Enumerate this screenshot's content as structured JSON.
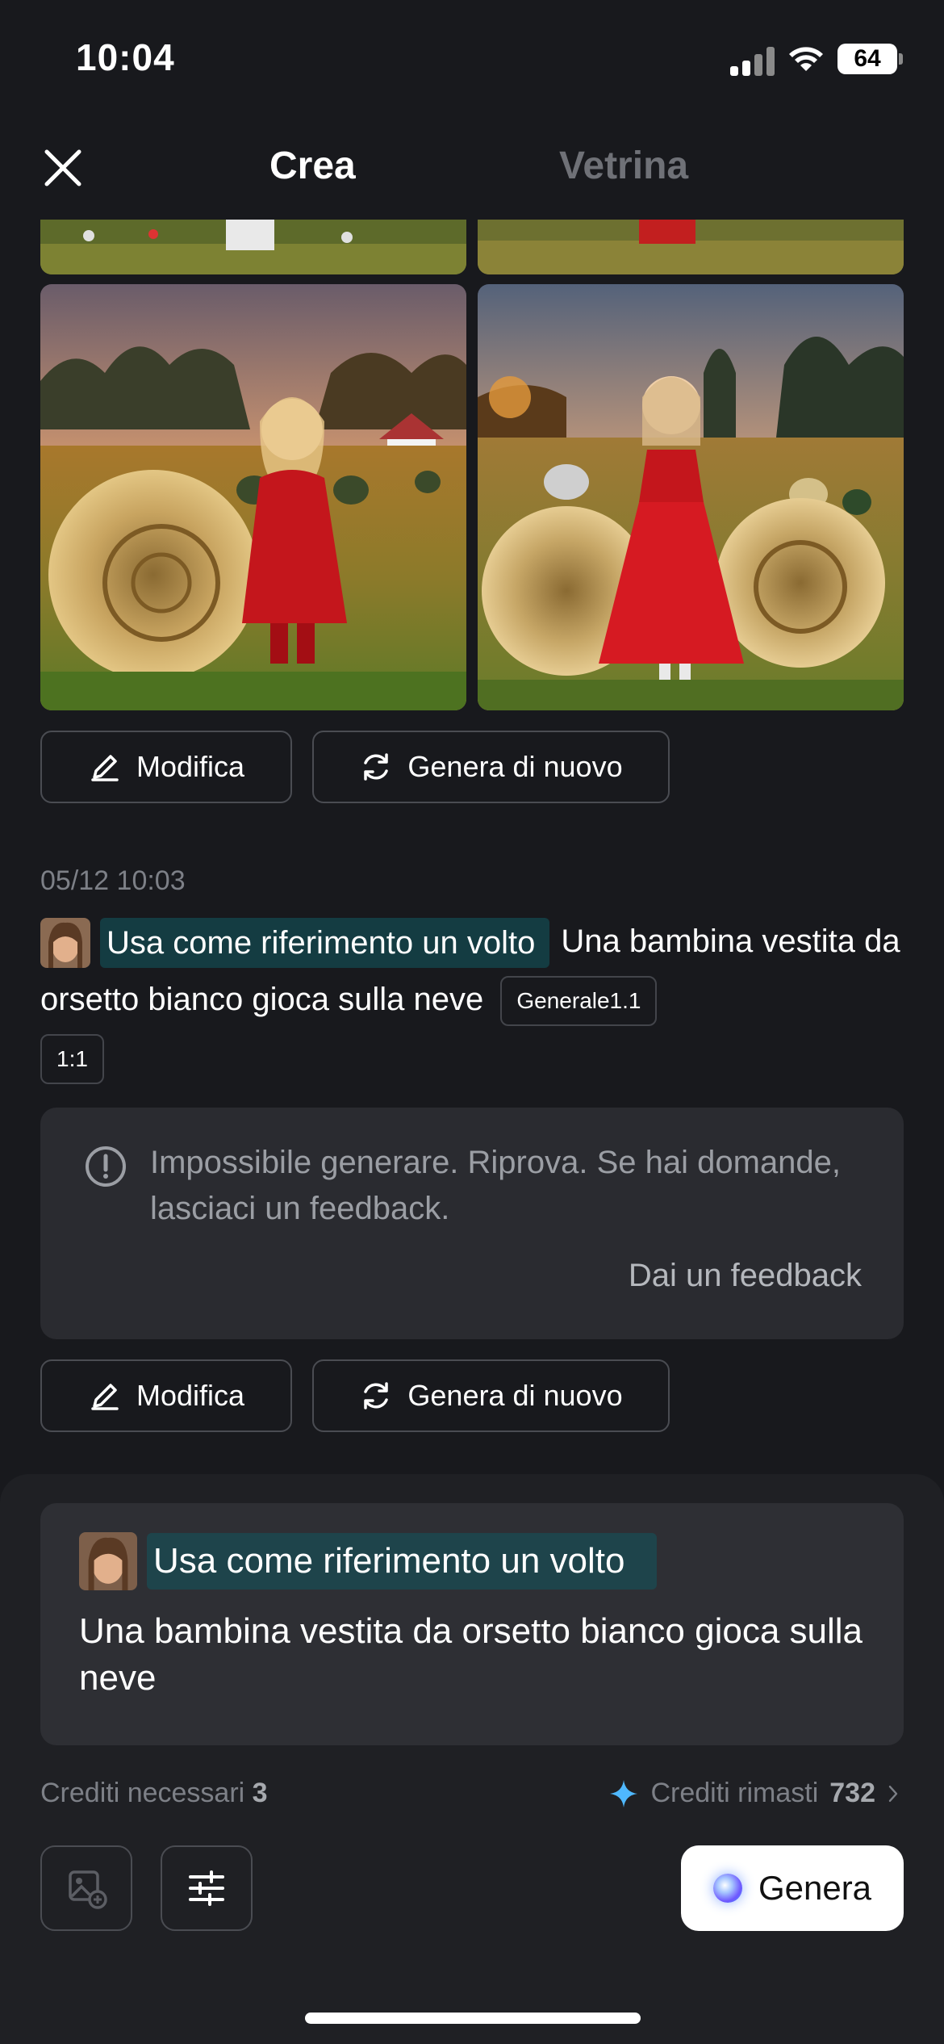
{
  "status_bar": {
    "time": "10:04",
    "battery": "64"
  },
  "header": {
    "close_icon": "close-icon",
    "tabs": [
      {
        "label": "Crea",
        "active": true
      },
      {
        "label": "Vetrina",
        "active": false
      }
    ]
  },
  "results": {
    "images": [
      {
        "name": "girl-red-coat-hay-bale",
        "description_icon": "photo"
      },
      {
        "name": "girl-red-dress-hay-bales",
        "description_icon": "photo"
      }
    ],
    "actions": {
      "edit_label": "Modifica",
      "regenerate_label": "Genera di nuovo"
    }
  },
  "message": {
    "timestamp": "05/12 10:03",
    "face_chip": "Usa come riferimento un volto",
    "prompt": "Una bambina vestita da orsetto bianco gioca sulla neve",
    "model_tag": "Generale1.1",
    "ratio_tag": "1:1",
    "error_text": "Impossibile generare. Riprova. Se hai domande, lasciaci un feedback.",
    "feedback_label": "Dai un feedback",
    "actions": {
      "edit_label": "Modifica",
      "regenerate_label": "Genera di nuovo"
    }
  },
  "composer": {
    "face_chip": "Usa come riferimento un volto",
    "prompt": "Una bambina vestita da orsetto bianco gioca sulla neve",
    "credits_needed_label": "Crediti necessari",
    "credits_needed_value": "3",
    "credits_left_label": "Crediti rimasti",
    "credits_left_value": "732",
    "generate_label": "Genera"
  },
  "colors": {
    "background": "#18191d",
    "card": "#2a2b30",
    "chip_teal": "#143c42",
    "accent_blue": "#4fb8ff"
  }
}
